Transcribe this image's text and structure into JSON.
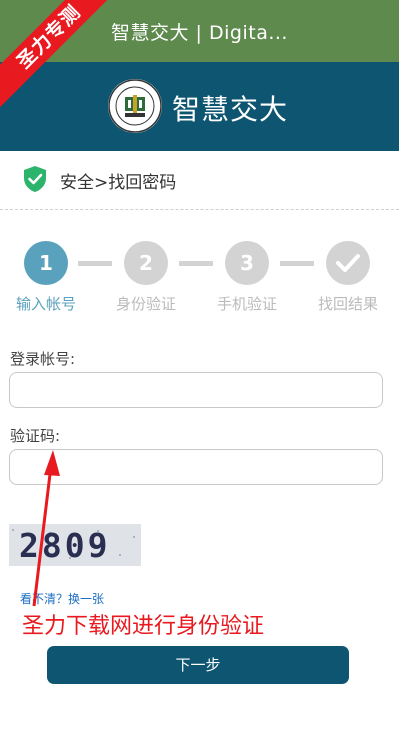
{
  "titlebar": {
    "title": "智慧交大 | Digita..."
  },
  "ribbon": {
    "text": "圣力专测"
  },
  "header": {
    "brand": "智慧交大",
    "logo_icon": "university-seal-icon"
  },
  "breadcrumb": {
    "text": "安全>找回密码",
    "icon": "shield-check-icon"
  },
  "steps": [
    {
      "number": "1",
      "label": "输入帐号",
      "state": "active"
    },
    {
      "number": "2",
      "label": "身份验证",
      "state": "pending"
    },
    {
      "number": "3",
      "label": "手机验证",
      "state": "pending"
    },
    {
      "number": "",
      "label": "找回结果",
      "state": "pending",
      "icon": "check-icon"
    }
  ],
  "form": {
    "account_label": "登录帐号:",
    "account_value": "",
    "captcha_label": "验证码:",
    "captcha_value": "",
    "captcha_image_text": "2809",
    "refresh_link": "看不清？换一张",
    "submit_label": "下一步"
  },
  "annotation": {
    "text": "圣力下载网进行身份验证"
  },
  "colors": {
    "titlebar": "#5e8a4e",
    "header": "#0d5570",
    "active_step": "#5aa1bd",
    "inactive_step": "#d3d3d3",
    "ribbon": "#e8191f",
    "shield": "#2db46c"
  }
}
